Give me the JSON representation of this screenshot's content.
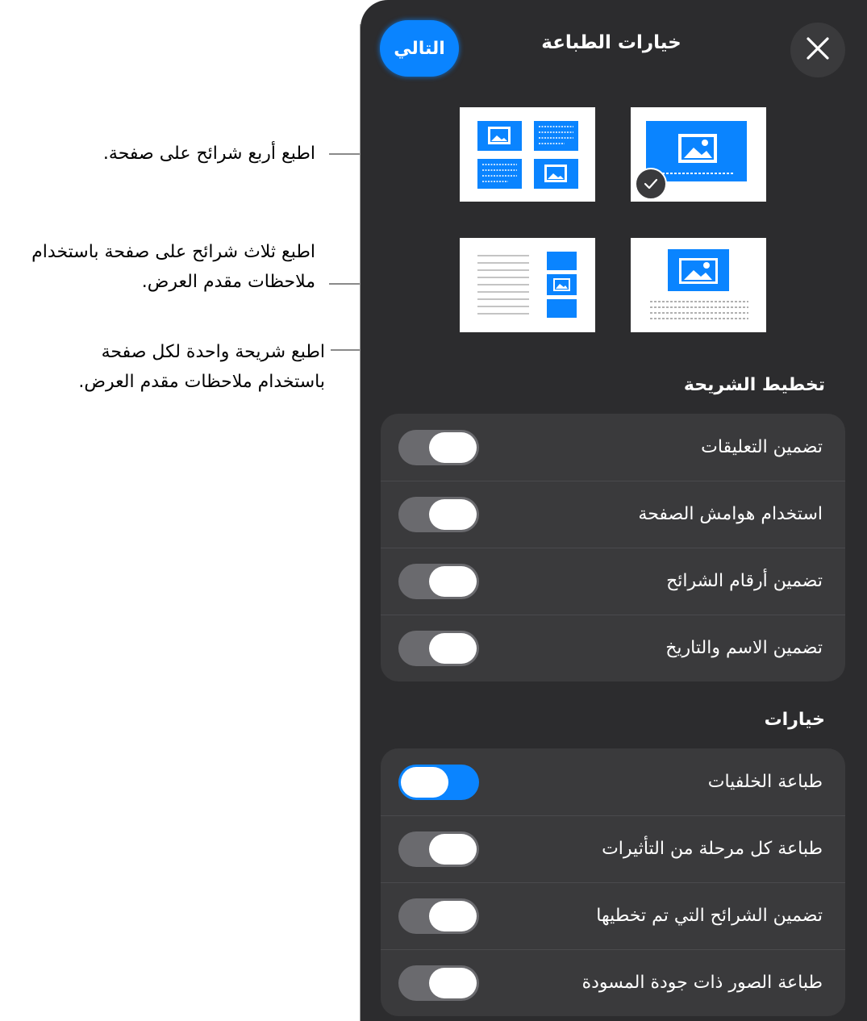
{
  "callouts": [
    {
      "lines": [
        "اطبع أربع شرائح على صفحة."
      ]
    },
    {
      "lines": [
        "اطبع ثلاث شرائح على صفحة باستخدام",
        "ملاحظات مقدم العرض."
      ]
    },
    {
      "lines": [
        "اطبع شريحة واحدة لكل صفحة",
        "باستخدام ملاحظات مقدم العرض."
      ]
    }
  ],
  "header": {
    "title": "خيارات الطباعة",
    "next_label": "التالي",
    "close_icon": "close-icon"
  },
  "layouts": [
    {
      "id": "single-slide",
      "selected": true
    },
    {
      "id": "four-slides",
      "selected": false
    },
    {
      "id": "single-slide-notes",
      "selected": false
    },
    {
      "id": "three-slides-notes",
      "selected": false
    }
  ],
  "slide_layout": {
    "heading": "تخطيط الشريحة",
    "rows": [
      {
        "label": "تضمين التعليقات",
        "on": false
      },
      {
        "label": "استخدام هوامش الصفحة",
        "on": false
      },
      {
        "label": "تضمين أرقام الشرائح",
        "on": false
      },
      {
        "label": "تضمين الاسم والتاريخ",
        "on": false
      }
    ]
  },
  "options": {
    "heading": "خيارات",
    "rows": [
      {
        "label": "طباعة الخلفيات",
        "on": true
      },
      {
        "label": "طباعة كل مرحلة من التأثيرات",
        "on": false
      },
      {
        "label": "تضمين الشرائح التي تم تخطيها",
        "on": false
      },
      {
        "label": "طباعة الصور ذات جودة المسودة",
        "on": false
      }
    ]
  },
  "colors": {
    "accent": "#0a84ff",
    "panel": "#2c2c2e",
    "group": "#3a3a3c"
  }
}
